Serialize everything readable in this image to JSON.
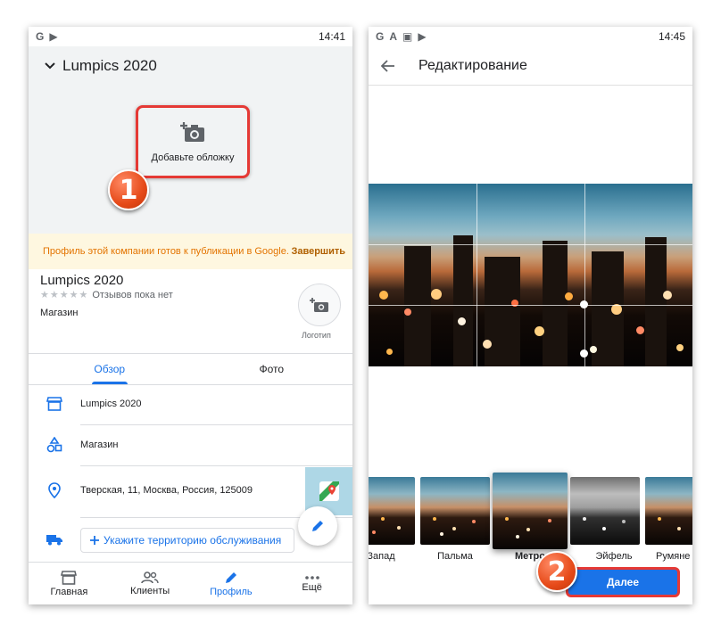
{
  "screen1": {
    "status_bar": {
      "icons": [
        "G",
        "▶"
      ],
      "time": "14:41"
    },
    "header": {
      "title": "Lumpics 2020"
    },
    "cover": {
      "label": "Добавьте обложку"
    },
    "step_badge": "1",
    "banner": {
      "text": "Профиль этой компании готов к публикации в Google.",
      "action": "Завершить"
    },
    "business": {
      "name": "Lumpics 2020",
      "stars": "★★★★★",
      "reviews": "Отзывов пока нет",
      "category": "Магазин",
      "logo_label": "Логотип"
    },
    "tabs": [
      {
        "label": "Обзор",
        "active": true
      },
      {
        "label": "Фото",
        "active": false
      }
    ],
    "info_rows": [
      {
        "icon": "storefront-icon",
        "value": "Lumpics 2020"
      },
      {
        "icon": "category-shapes-icon",
        "value": "Магазин"
      },
      {
        "icon": "location-pin-icon",
        "value": "Тверская, 11, Москва, Россия, 125009"
      }
    ],
    "service_area_button": "Укажите территорию обслуживания",
    "bottom_nav": [
      {
        "label": "Главная",
        "icon": "storefront-icon",
        "active": false
      },
      {
        "label": "Клиенты",
        "icon": "people-icon",
        "active": false
      },
      {
        "label": "Профиль",
        "icon": "pencil-icon",
        "active": true
      },
      {
        "label": "Ещё",
        "icon": "more-icon",
        "active": false
      }
    ]
  },
  "screen2": {
    "status_bar": {
      "icons": [
        "G",
        "A",
        "▣",
        "▶"
      ],
      "time": "14:45"
    },
    "header": {
      "title": "Редактирование"
    },
    "filters": [
      {
        "label": "Запад",
        "selected": false
      },
      {
        "label": "Пальма",
        "selected": false
      },
      {
        "label": "Метро",
        "selected": true
      },
      {
        "label": "Эйфель",
        "selected": false
      },
      {
        "label": "Румяне",
        "selected": false
      }
    ],
    "next_button": "Далее",
    "step_badge": "2"
  },
  "colors": {
    "accent": "#1a73e8",
    "highlight_border": "#e53935",
    "banner_bg": "#fef7e0",
    "banner_text": "#e37400",
    "badge": "#e64a19"
  }
}
